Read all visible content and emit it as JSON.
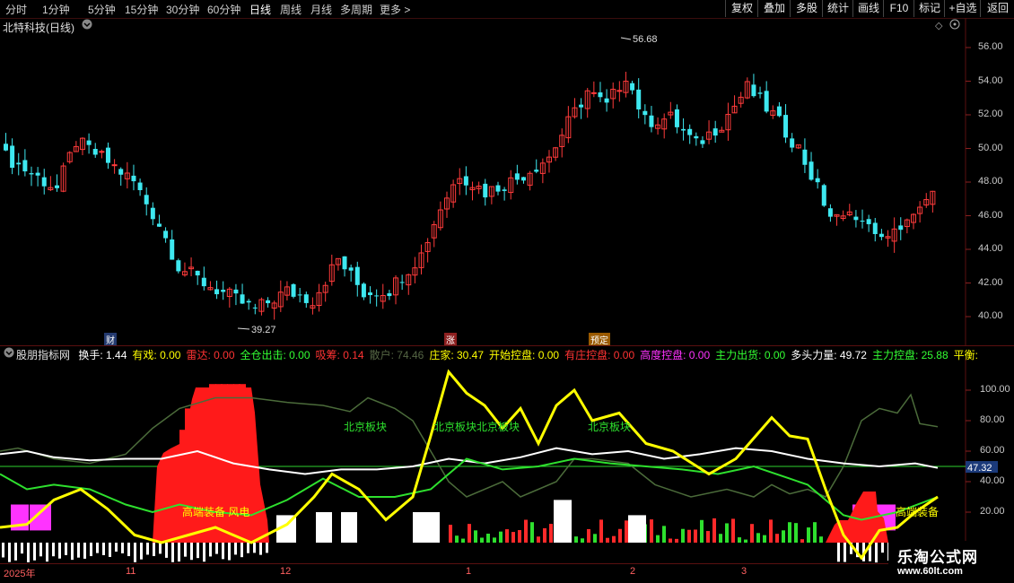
{
  "toolbar": {
    "periods": [
      "分时",
      "1分钟",
      "5分钟",
      "15分钟",
      "30分钟",
      "60分钟",
      "日线",
      "周线",
      "月线",
      "多周期",
      "更多 >"
    ],
    "active_period": "日线",
    "right_buttons": [
      "复权",
      "叠加",
      "多股",
      "统计",
      "画线",
      "F10",
      "标记",
      "+自选",
      "返回"
    ]
  },
  "main_pane": {
    "title": "北特科技(日线)",
    "price_high_label": "56.68",
    "price_low_label": "39.27",
    "axis_ticks": [
      "56.00",
      "54.00",
      "52.00",
      "50.00",
      "48.00",
      "46.00",
      "44.00",
      "42.00",
      "40.00"
    ],
    "markers": {
      "cai": "财",
      "zhang": "涨",
      "yuding": "预定"
    },
    "colors": {
      "up": "#ff3b3b",
      "down": "#3ee8f0"
    }
  },
  "indicator": {
    "name": "股朋指标网",
    "fields": [
      {
        "label": "换手:",
        "value": "1.44",
        "color": "#ffffff"
      },
      {
        "label": "有戏:",
        "value": "0.00",
        "color": "#ffff00"
      },
      {
        "label": "雷达:",
        "value": "0.00",
        "color": "#ff3333"
      },
      {
        "label": "全仓出击:",
        "value": "0.00",
        "color": "#33ff33"
      },
      {
        "label": "吸筹:",
        "value": "0.14",
        "color": "#ff3333"
      },
      {
        "label": "散户:",
        "value": "74.46",
        "color": "#556644"
      },
      {
        "label": "庄家:",
        "value": "30.47",
        "color": "#ffff00"
      },
      {
        "label": "开始控盘:",
        "value": "0.00",
        "color": "#ffff00"
      },
      {
        "label": "有庄控盘:",
        "value": "0.00",
        "color": "#ff3333"
      },
      {
        "label": "高度控盘:",
        "value": "0.00",
        "color": "#ff33ff"
      },
      {
        "label": "主力出货:",
        "value": "0.00",
        "color": "#33ff33"
      },
      {
        "label": "多头力量:",
        "value": "49.72",
        "color": "#ffffff"
      },
      {
        "label": "主力控盘:",
        "value": "25.88",
        "color": "#33ff33"
      },
      {
        "label": "平衡:",
        "value": "",
        "color": "#ffff00"
      }
    ],
    "axis_ticks": [
      "100.00",
      "80.00",
      "60.00",
      "40.00",
      "20.00"
    ],
    "current_value": "47.32",
    "texts": {
      "beijing1": "北京板块",
      "beijing2": "北京板块北京板块",
      "beijing3": "北京板块",
      "gaoduan1": "高端装备 风电",
      "gaoduan2": "高端装备"
    }
  },
  "time_axis": {
    "labels": [
      "2025年",
      "11",
      "12",
      "1",
      "2",
      "3"
    ]
  },
  "watermark": {
    "line1": "乐淘公式网",
    "line2": "www.60lt.com"
  }
}
